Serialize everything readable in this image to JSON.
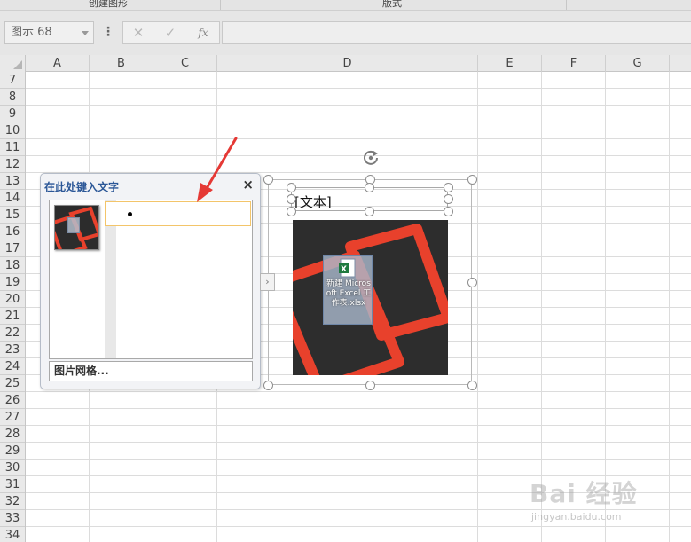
{
  "ribbon": {
    "groups": [
      "创建图形",
      "版式"
    ]
  },
  "formula_bar": {
    "name_box": "图示 68",
    "more_icon": "vertical-ellipsis",
    "cancel_icon": "✕",
    "confirm_icon": "✓",
    "function_label": "fx",
    "formula_value": ""
  },
  "sheet": {
    "columns": [
      "A",
      "B",
      "C",
      "D",
      "E",
      "F",
      "G"
    ],
    "rows": [
      "7",
      "8",
      "9",
      "10",
      "11",
      "12",
      "13",
      "14",
      "15",
      "16",
      "17",
      "18",
      "19",
      "20",
      "21",
      "22",
      "23",
      "24",
      "25",
      "26",
      "27",
      "28",
      "29",
      "30",
      "31",
      "32",
      "33",
      "34"
    ]
  },
  "text_pane": {
    "title": "在此处键入文字",
    "close_label": "×",
    "bullet_text": "",
    "footer_link": "图片网格...",
    "expander_label": "›"
  },
  "smartart": {
    "text_placeholder": "[文本]",
    "file_icon_label": "新建 Microsoft Excel 工作表.xlsx"
  },
  "watermark": {
    "main": "Bai 经验",
    "sub": "jingyan.baidu.com"
  },
  "colors": {
    "annotation_arrow": "#e53935",
    "logo_red": "#e8412c",
    "pane_title": "#2b5797",
    "input_highlight": "#f3c56a"
  }
}
